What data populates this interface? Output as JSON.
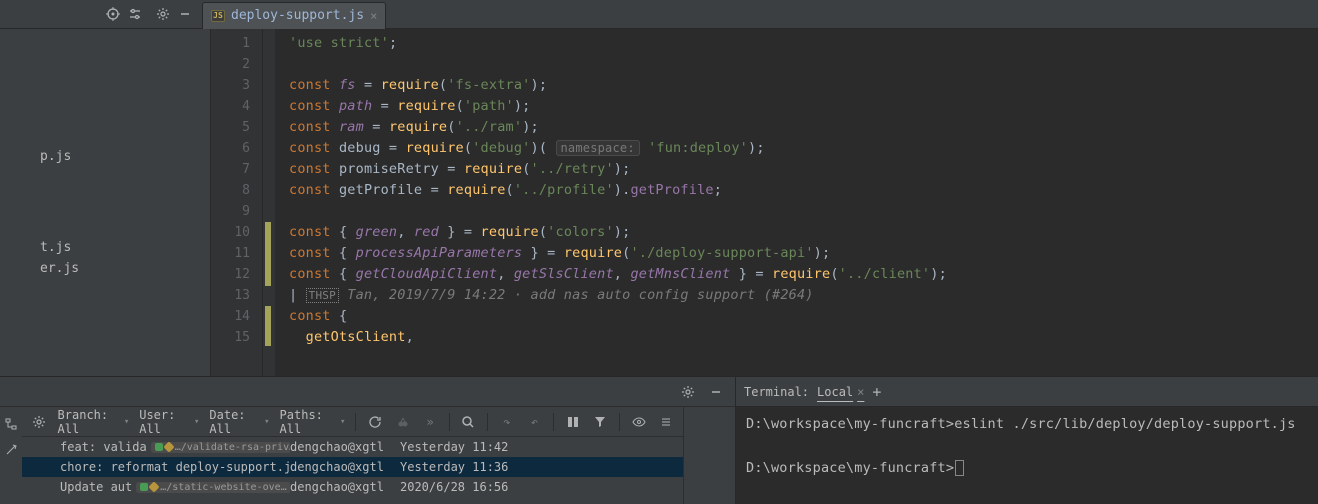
{
  "tab": {
    "filename": "deploy-support.js",
    "badge": "JS"
  },
  "sidebar": {
    "items": [
      "p.js",
      "t.js",
      "er.js"
    ]
  },
  "editor": {
    "blame": {
      "mark": "THSP",
      "text": "Tan, 2019/7/9 14:22 · add nas auto config support (#264)"
    },
    "hint_label": "namespace:",
    "hint_value": "'fun:deploy'",
    "lines": {
      "s1": "'use strict'",
      "c": "const ",
      "fs": "fs",
      "path": "path",
      "ram": "ram",
      "debug": "debug",
      "promiseRetry": "promiseRetry",
      "getProfileVar": "getProfile",
      "req": "require",
      "fsextra": "'fs-extra'",
      "pathS": "'path'",
      "ramS": "'../ram'",
      "debugS": "'debug'",
      "retryS": "'../retry'",
      "profileS": "'../profile'",
      "getProfileP": "getProfile",
      "green": "green",
      "red": "red",
      "colorsS": "'colors'",
      "processApi": "processApiParameters",
      "dsApi": "'./deploy-support-api'",
      "gc1": "getCloudApiClient",
      "gc2": "getSlsClient",
      "gc3": "getMnsClient",
      "clientS": "'../client'",
      "getOts": "getOtsClient"
    },
    "line_numbers": [
      "1",
      "2",
      "3",
      "4",
      "5",
      "6",
      "7",
      "8",
      "9",
      "10",
      "11",
      "12",
      "13",
      "14",
      "15"
    ]
  },
  "vcs": {
    "filters": {
      "branch": "Branch: All",
      "user": "User: All",
      "date": "Date: All",
      "paths": "Paths: All"
    },
    "commits": [
      {
        "msg": "feat: valida",
        "badge": "/validate-rsa-priv…",
        "author": "dengchao@xgtl",
        "date": "Yesterday 11:42",
        "badges": true
      },
      {
        "msg": "chore: reformat deploy-support.js",
        "author": "dengchao@xgtl",
        "date": "Yesterday 11:36",
        "sel": true
      },
      {
        "msg": "Update aut",
        "badge": "/static-website-ove…",
        "author": "dengchao@xgtl",
        "date": "2020/6/28 16:56",
        "badges": true
      }
    ]
  },
  "terminal": {
    "title": "Terminal:",
    "tab": "Local",
    "line1": "D:\\workspace\\my-funcraft>eslint ./src/lib/deploy/deploy-support.js",
    "line2": "D:\\workspace\\my-funcraft>"
  },
  "chart_data": null
}
